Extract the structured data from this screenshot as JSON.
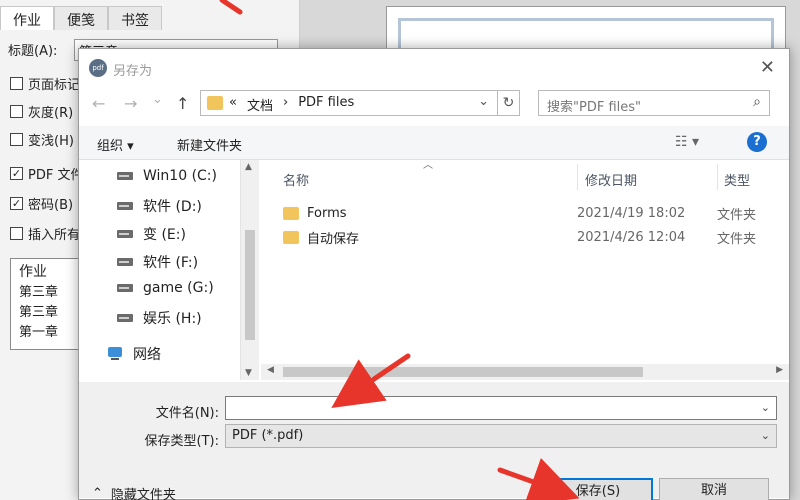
{
  "background": {
    "tabs": [
      "作业",
      "便笺",
      "书签"
    ],
    "title_label": "标题(A):",
    "title_value": "第三章",
    "checkboxes": [
      {
        "label": "页面标记",
        "checked": false
      },
      {
        "label": "灰度(R)",
        "checked": false
      },
      {
        "label": "变浅(H)",
        "checked": false
      },
      {
        "label": "PDF 文件",
        "checked": true
      },
      {
        "label": "密码(B)",
        "checked": true
      },
      {
        "label": "插入所有",
        "checked": false
      }
    ],
    "list_header": "作业",
    "list_items": [
      "第三章",
      "第三章",
      "第一章"
    ]
  },
  "dialog": {
    "title": "另存为",
    "app_icon_text": "pdf",
    "close_glyph": "✕",
    "nav": {
      "back": "←",
      "forward": "→",
      "dropdown": "⌄",
      "up": "↑"
    },
    "address": {
      "prefix": "«",
      "crumbs": [
        "文档",
        "›",
        "PDF files"
      ],
      "dropdown": "⌄",
      "refresh": "↻"
    },
    "search_placeholder": "搜索\"PDF files\"",
    "search_icon": "⌕",
    "toolbar": {
      "organize": "组织 ▾",
      "new_folder": "新建文件夹",
      "view": "☷ ▾",
      "help": "?"
    },
    "nav_pane": [
      {
        "label": "Win10 (C:)",
        "icon": "system-drive-icon"
      },
      {
        "label": "软件 (D:)",
        "icon": "drive-icon"
      },
      {
        "label": "变 (E:)",
        "icon": "drive-icon"
      },
      {
        "label": "软件 (F:)",
        "icon": "drive-icon"
      },
      {
        "label": "game (G:)",
        "icon": "drive-icon"
      },
      {
        "label": "娱乐 (H:)",
        "icon": "drive-icon"
      },
      {
        "label": "网络",
        "icon": "network-icon"
      }
    ],
    "columns": [
      "名称",
      "修改日期",
      "类型"
    ],
    "files": [
      {
        "name": "Forms",
        "date": "2021/4/19 18:02",
        "type": "文件夹"
      },
      {
        "name": "自动保存",
        "date": "2021/4/26 12:04",
        "type": "文件夹"
      }
    ],
    "form": {
      "filename_label": "文件名(N):",
      "filename_value": "",
      "filetype_label": "保存类型(T):",
      "filetype_value": "PDF (*.pdf)",
      "hide_folders": "隐藏文件夹",
      "save": "保存(S)",
      "cancel": "取消"
    }
  },
  "colors": {
    "annotation_arrow": "#e8352b",
    "accent": "#0078d7",
    "folder": "#f2c55c"
  }
}
